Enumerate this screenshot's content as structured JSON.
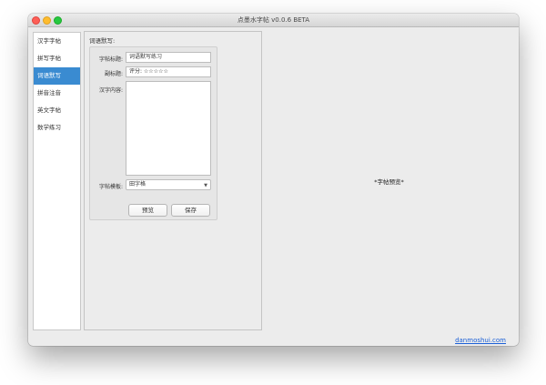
{
  "window": {
    "title": "点墨水字帖 v0.0.6 BETA"
  },
  "sidebar": {
    "items": [
      {
        "label": "汉字字帖",
        "active": false
      },
      {
        "label": "拼写字帖",
        "active": false
      },
      {
        "label": "词语默写",
        "active": true
      },
      {
        "label": "拼音注音",
        "active": false
      },
      {
        "label": "英文字帖",
        "active": false
      },
      {
        "label": "数学练习",
        "active": false
      }
    ]
  },
  "panel": {
    "heading": "词语默写:",
    "form": {
      "title_label": "字帖标题:",
      "title_value": "词语默写练习",
      "subtitle_label": "副标题:",
      "subtitle_value": "评分: ☆☆☆☆☆",
      "content_label": "汉字内容:",
      "content_value": "",
      "template_label": "字帖模板:",
      "template_value": "田字格"
    },
    "buttons": {
      "preview": "预览",
      "save": "保存"
    }
  },
  "preview": {
    "placeholder": "*字帖预览*"
  },
  "footer": {
    "link": "danmoshui.com"
  },
  "colors": {
    "accent": "#3a8bd1",
    "link": "#1a5fd6"
  }
}
